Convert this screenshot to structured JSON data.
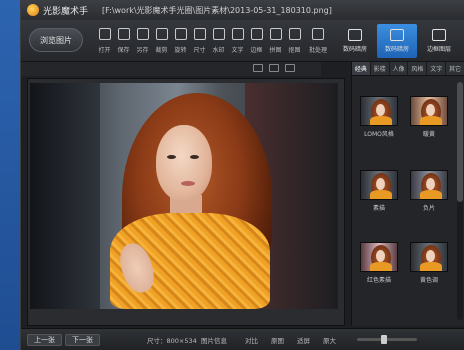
{
  "window": {
    "app_name": "光影魔术手",
    "file_path": "[F:\\work\\光影魔术手光圈\\图片素材\\2013-05-31_180310.png]"
  },
  "toolbar": {
    "open_label": "浏览图片",
    "tools": [
      {
        "label": "打开",
        "icon": "folder-icon"
      },
      {
        "label": "保存",
        "icon": "save-icon"
      },
      {
        "label": "另存",
        "icon": "save-as-icon"
      },
      {
        "label": "裁剪",
        "icon": "crop-icon"
      },
      {
        "label": "旋转",
        "icon": "rotate-icon"
      },
      {
        "label": "尺寸",
        "icon": "resize-icon"
      },
      {
        "label": "水印",
        "icon": "watermark-icon"
      },
      {
        "label": "文字",
        "icon": "text-icon"
      },
      {
        "label": "边框",
        "icon": "frame-icon"
      },
      {
        "label": "拼图",
        "icon": "collage-icon"
      },
      {
        "label": "抠图",
        "icon": "cutout-icon"
      },
      {
        "label": "批处理",
        "icon": "batch-icon"
      }
    ],
    "modes": [
      {
        "label": "数码暗房",
        "icon": "darkroom-icon",
        "active": false
      },
      {
        "label": "数码暗房",
        "icon": "camera-icon",
        "active": true
      },
      {
        "label": "边框图层",
        "icon": "layers-icon",
        "active": false
      }
    ]
  },
  "panel": {
    "tabs": [
      "经典",
      "影楼",
      "人像",
      "风格",
      "文字",
      "其它"
    ],
    "effects": [
      {
        "label": "LOMO风格"
      },
      {
        "label": "暖黄"
      },
      {
        "label": "素描"
      },
      {
        "label": "负片"
      },
      {
        "label": "红色素描"
      },
      {
        "label": "黄色调"
      }
    ]
  },
  "statusbar": {
    "prev_label": "上一张",
    "next_label": "下一张",
    "size_text": "尺寸：800×534",
    "info_text": "图片信息",
    "compare_text": "对比",
    "original_text": "原图",
    "fit_text": "适屏",
    "zoom_text": "原大"
  }
}
